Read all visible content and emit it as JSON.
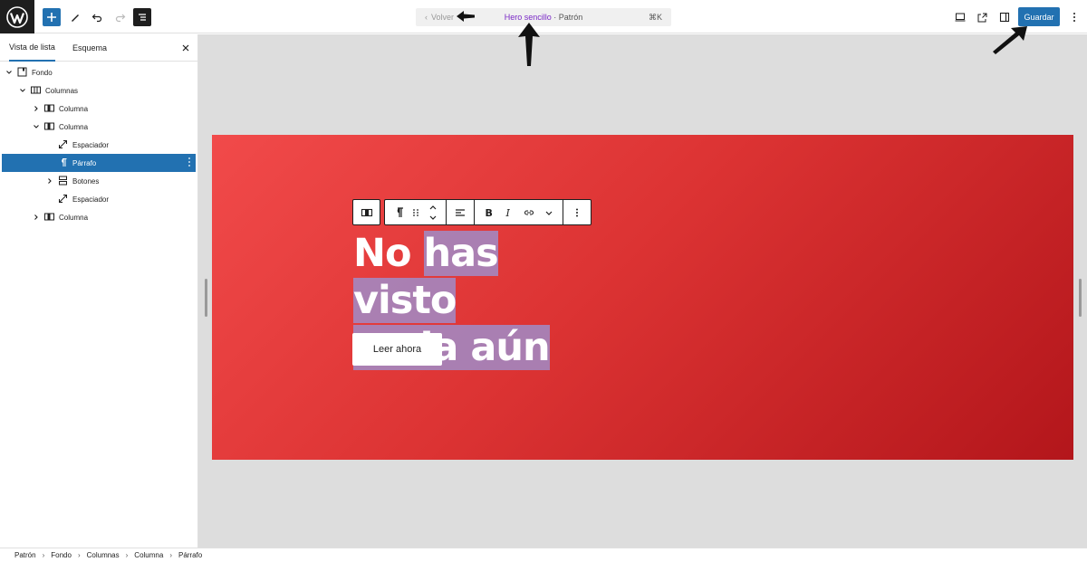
{
  "toolbar": {
    "add": "add",
    "tools": "tools",
    "undo": "undo",
    "redo": "redo",
    "list_view": "list view"
  },
  "command": {
    "back": "Volver",
    "title": "Hero sencillo",
    "dot": " · ",
    "type": "Patrón",
    "shortcut": "⌘K"
  },
  "actions": {
    "save": "Guardar"
  },
  "sidebar": {
    "tabs": [
      "Vista de lista",
      "Esquema"
    ],
    "items": [
      {
        "label": "Fondo",
        "depth": 0,
        "expanded": true,
        "icon": "cover-icon"
      },
      {
        "label": "Columnas",
        "depth": 1,
        "expanded": true,
        "icon": "columns-icon"
      },
      {
        "label": "Columna",
        "depth": 2,
        "expanded": false,
        "icon": "column-icon"
      },
      {
        "label": "Columna",
        "depth": 2,
        "expanded": true,
        "icon": "column-icon"
      },
      {
        "label": "Espaciador",
        "depth": 3,
        "icon": "spacer-icon"
      },
      {
        "label": "Párrafo",
        "depth": 3,
        "selected": true,
        "icon": "paragraph-icon"
      },
      {
        "label": "Botones",
        "depth": 3,
        "expanded": false,
        "icon": "buttons-icon"
      },
      {
        "label": "Espaciador",
        "depth": 3,
        "icon": "spacer-icon"
      },
      {
        "label": "Columna",
        "depth": 2,
        "expanded": false,
        "icon": "column-icon"
      }
    ]
  },
  "hero": {
    "headline_part1": "No ",
    "headline_part2": "has visto",
    "headline_part3": "nada aún",
    "button": "Leer ahora"
  },
  "breadcrumb": [
    "Patrón",
    "Fondo",
    "Columnas",
    "Columna",
    "Párrafo"
  ],
  "colors": {
    "accent": "#2271b1",
    "hero_start": "#f14a4a",
    "hero_end": "#b3161b",
    "selection": "#a08cc8",
    "title_link": "#7a29c6"
  }
}
